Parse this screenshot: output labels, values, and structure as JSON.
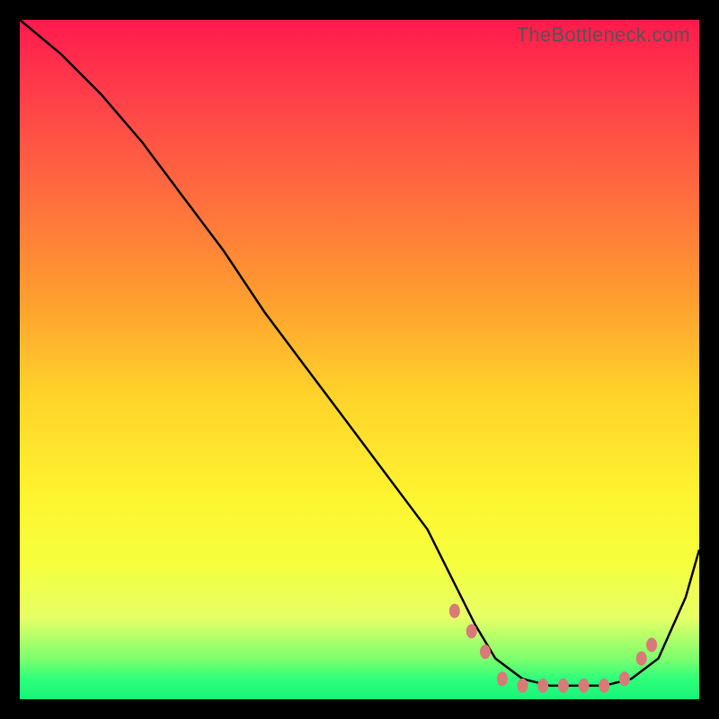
{
  "watermark": "TheBottleneck.com",
  "colors": {
    "background": "#000000",
    "curve": "#000000",
    "marker": "#d97a78",
    "gradient_top": "#ff1a4d",
    "gradient_bottom": "#18f57a"
  },
  "chart_data": {
    "type": "line",
    "title": "",
    "xlabel": "",
    "ylabel": "",
    "xlim": [
      0,
      100
    ],
    "ylim": [
      0,
      100
    ],
    "grid": false,
    "series": [
      {
        "name": "bottleneck-curve",
        "x": [
          0,
          6,
          12,
          18,
          24,
          30,
          36,
          42,
          48,
          54,
          60,
          64,
          67,
          70,
          74,
          78,
          82,
          86,
          90,
          94,
          98,
          100
        ],
        "y": [
          100,
          95,
          89,
          82,
          74,
          66,
          57,
          49,
          41,
          33,
          25,
          17,
          11,
          6,
          3,
          2,
          2,
          2,
          3,
          6,
          15,
          22
        ]
      }
    ],
    "markers": [
      {
        "x": 64.0,
        "y": 13.0
      },
      {
        "x": 66.5,
        "y": 10.0
      },
      {
        "x": 68.5,
        "y": 7.0
      },
      {
        "x": 71.0,
        "y": 3.0
      },
      {
        "x": 74.0,
        "y": 2.0
      },
      {
        "x": 77.0,
        "y": 2.0
      },
      {
        "x": 80.0,
        "y": 2.0
      },
      {
        "x": 83.0,
        "y": 2.0
      },
      {
        "x": 86.0,
        "y": 2.0
      },
      {
        "x": 89.0,
        "y": 3.0
      },
      {
        "x": 91.5,
        "y": 6.0
      },
      {
        "x": 93.0,
        "y": 8.0
      }
    ]
  }
}
